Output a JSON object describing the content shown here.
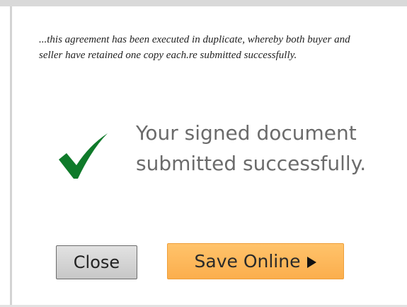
{
  "note": {
    "text": "...this agreement has been executed in duplicate, whereby both buyer and seller have retained one copy each.re submitted successfully."
  },
  "status": {
    "line1": "Your signed document",
    "line2": "submitted successfully.",
    "icon": "checkmark-icon",
    "icon_color": "#0f7a2a"
  },
  "buttons": {
    "close_label": "Close",
    "save_label": "Save Online",
    "save_icon": "play-arrow-icon"
  },
  "colors": {
    "save_button": "#fcb45a",
    "close_button": "#d4d4d4",
    "message_text": "#6b6b6b"
  }
}
